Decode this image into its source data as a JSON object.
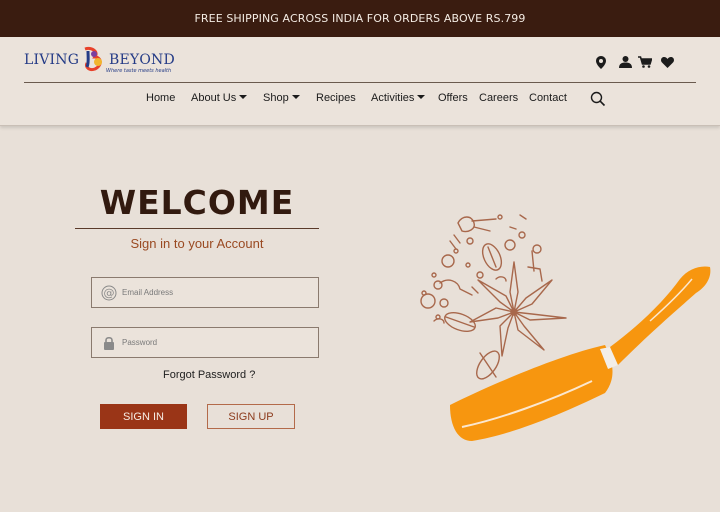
{
  "promo": {
    "text": "FREE SHIPPING ACROSS INDIA FOR ORDERS ABOVE RS.799"
  },
  "brand": {
    "left": "LIVING",
    "right": "BEYOND",
    "tagline": "Where taste meets health"
  },
  "header_icons": [
    "location-icon",
    "user-icon",
    "cart-icon",
    "heart-icon"
  ],
  "nav": {
    "items": [
      {
        "label": "Home",
        "dropdown": false
      },
      {
        "label": "About Us",
        "dropdown": true
      },
      {
        "label": "Shop",
        "dropdown": true
      },
      {
        "label": "Recipes",
        "dropdown": false
      },
      {
        "label": "Activities",
        "dropdown": true
      },
      {
        "label": "Offers",
        "dropdown": false
      },
      {
        "label": "Careers",
        "dropdown": false
      },
      {
        "label": "Contact",
        "dropdown": false
      }
    ]
  },
  "login": {
    "title": "WELCOME",
    "subtitle": "Sign in to your Account",
    "email_placeholder": "Email Address",
    "password_placeholder": "Password",
    "forgot": "Forgot Password ?",
    "signin": "SIGN IN",
    "signup": "SIGN UP"
  },
  "colors": {
    "promo_bg": "#3a1c10",
    "page_bg": "#e8e0d8",
    "accent": "#9a3517",
    "brand_blue": "#243b86",
    "pan_orange": "#f7960f",
    "spice_outline": "#a8684c"
  }
}
